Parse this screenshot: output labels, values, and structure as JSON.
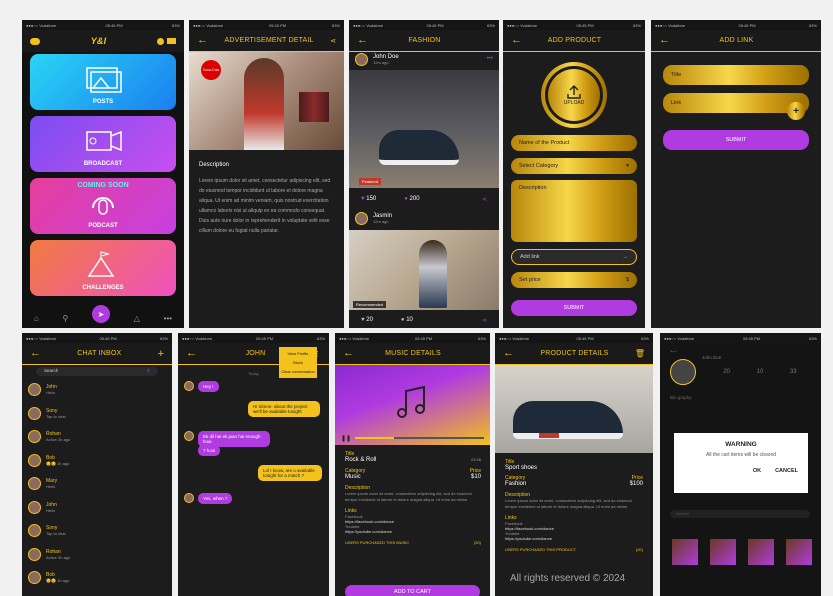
{
  "status": {
    "carrier": "●●●○○ Vodafone",
    "time": "05:45 PM",
    "battery": "63%"
  },
  "home": {
    "logo": "Y&I",
    "tiles": [
      "POSTS",
      "BROADCAST",
      "PODCAST",
      "CHALLENGES"
    ],
    "coming_soon": "COMING SOON"
  },
  "ad": {
    "title": "ADVERTISEMENT DETAIL",
    "brand": "Coca-Cola",
    "desc_label": "Description",
    "desc": "Lorem ipsum dolor sit amet, consectetur adipiscing elit, sed do eiusmod tempor incididunt ut labore et dolore magna aliqua. Ut enim ad minim veniam, quis nostrud exercitation ullamco laboris nisi ut aliquip ex ea commodo consequat. Duis aute irure dolor in reprehenderit in voluptate velit esse cillum dolore eu fugiat nulla pariatur."
  },
  "fashion": {
    "title": "FASHION",
    "post1": {
      "user": "John Doe",
      "time": "12m ago",
      "badge": "Featured",
      "likes": "150",
      "comments": "200"
    },
    "post2": {
      "user": "Jasmin",
      "time": "12m ago",
      "badge": "Recommended",
      "likes": "20",
      "comments": "10"
    }
  },
  "add_product": {
    "title": "ADD PRODUCT",
    "upload": "UPLOAD",
    "name": "Name of the Product",
    "category": "Select Category",
    "description": "Description",
    "link": "Add link",
    "price": "Set price",
    "price_icon": "$",
    "submit": "SUBMIT"
  },
  "add_link": {
    "title": "ADD LINK",
    "field1": "Title",
    "field2": "Link",
    "submit": "SUBMIT"
  },
  "chat": {
    "title": "CHAT INBOX",
    "search": "Search",
    "items": [
      {
        "name": "John",
        "msg": "Hello"
      },
      {
        "name": "Sony",
        "msg": "Tap to chat"
      },
      {
        "name": "Rohan",
        "msg": "Active 3h ago"
      },
      {
        "name": "Bob",
        "msg": "😊😊 1h ago"
      },
      {
        "name": "Mary",
        "msg": "Hello"
      },
      {
        "name": "John",
        "msg": "Hello"
      },
      {
        "name": "Sony",
        "msg": "Tap to chat"
      },
      {
        "name": "Rohan",
        "msg": "Active 3h ago"
      },
      {
        "name": "Bob",
        "msg": "😊😊 1h ago"
      }
    ]
  },
  "john": {
    "title": "JOHN",
    "menu": [
      "View Profile",
      "Block",
      "Clear conversation"
    ],
    "date": "Today",
    "m1": "Hey !",
    "m2": "Hi Simon- about the project we'll be available tonight",
    "m3": "Ek dil hai ek jaan hai enough hoai",
    "m4": "? hoxi",
    "m5": "Lol I know, are u available tonight for a match ?",
    "m6": "Yes, when ?"
  },
  "music": {
    "title": "MUSIC DETAILS",
    "title_label": "Title",
    "title_val": "Rock & Roll",
    "dur": "03:48",
    "cat_label": "Category",
    "cat_val": "Music",
    "price_label": "Price",
    "price_val": "$10",
    "desc_label": "Description",
    "desc": "Lorem ipsum dolor sit amet, consectetur adipiscing elit, sed do eiusmod tempor incididunt ut labore et dolore magna aliqua. Ut enim ad minim",
    "links": "Links",
    "fb_label": "Facebook",
    "fb": "https://facebook.com/dance",
    "yt_label": "Youtube",
    "yt": "https://youtube.com/dance",
    "users": "USERS PURCHASED THIS MUSIC",
    "count": "(20)",
    "btn": "ADD TO CART",
    "progress": 0.3
  },
  "product": {
    "title": "PRODUCT DETAILS",
    "title_label": "Title",
    "title_val": "Sport shoes",
    "cat_label": "Category",
    "cat_val": "Fashion",
    "price_label": "Price",
    "price_val": "$100",
    "desc_label": "Description",
    "desc": "Lorem ipsum dolor sit amet, consectetur adipiscing elit, sed do eiusmod tempor incididunt ut labore et dolore magna aliqua. Ut enim ad minim",
    "links": "Links",
    "fb_label": "Facebook",
    "fb": "https://facebook.com/dance",
    "yt_label": "Youtube",
    "yt": "https://youtube.com/dance",
    "users": "USERS PURCHASED THIS PRODUCT",
    "count": "(20)"
  },
  "profile": {
    "name": "John Doe",
    "stats": [
      "20",
      "10",
      "33"
    ],
    "bio": "Bio graphy",
    "warning_title": "WARNING",
    "warning_msg": "All the cart items will be cleared",
    "ok": "OK",
    "cancel": "CANCEL",
    "search": "Search",
    "watermark": "All rights reserved © 2024"
  },
  "colors": {
    "accent": "#f3c21c",
    "purple": "#b03be0"
  }
}
